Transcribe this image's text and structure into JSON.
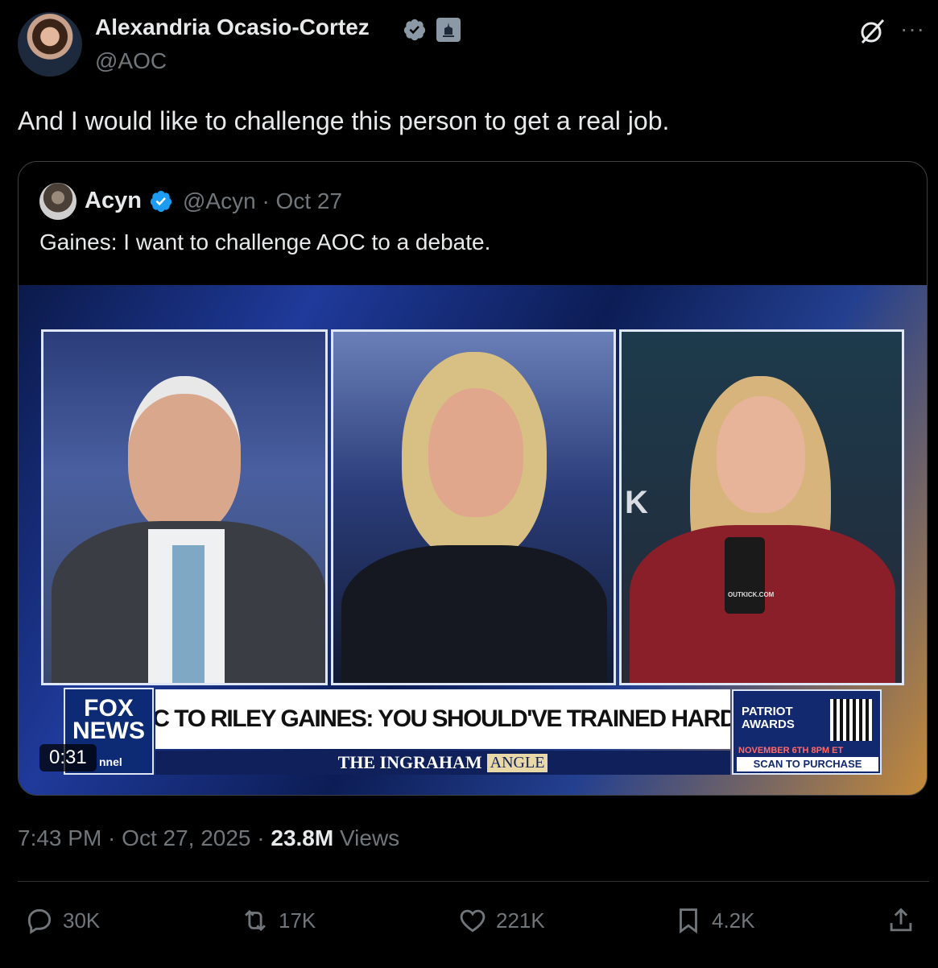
{
  "author": {
    "name": "Alexandria Ocasio-Cortez",
    "handle": "@AOC",
    "verified_color": "#8b98a5"
  },
  "tweet": {
    "text": "And I would like to challenge this person to get a real job."
  },
  "quoted": {
    "name": "Acyn",
    "handle_date": "@Acyn · Oct 27",
    "text": "Gaines: I want to challenge AOC to a debate.",
    "verified_color": "#1d9bf0",
    "video": {
      "duration": "0:31",
      "logo_line1": "FOX",
      "logo_line2": "NEWS",
      "logo_channel": "nnel",
      "headline": "AOC TO RILEY GAINES: YOU SHOULD'VE TRAINED HARDER",
      "show_name_a": "THE INGRAHAM",
      "show_name_b": "ANGLE",
      "promo_title_a": "PATRIOT",
      "promo_title_b": "AWARDS",
      "promo_date": "NOVEMBER 6TH 8PM ET",
      "promo_cta": "SCAN TO PURCHASE",
      "mic_label": "OUTKICK.COM",
      "backdrop_text": "K"
    }
  },
  "meta": {
    "time_date": "7:43 PM · Oct 27, 2025 · ",
    "views_count": "23.8M",
    "views_label": "Views"
  },
  "actions": {
    "replies": "30K",
    "reposts": "17K",
    "likes": "221K",
    "bookmarks": "4.2K"
  }
}
